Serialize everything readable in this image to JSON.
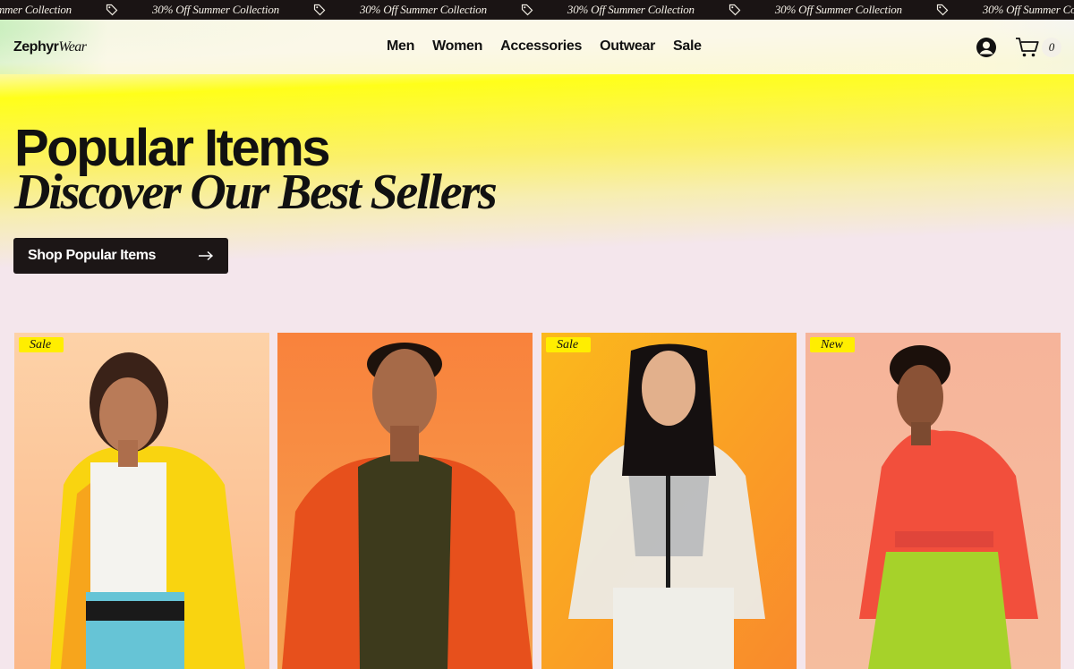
{
  "announcement": {
    "messages": [
      "30% Off Summer Collection",
      "30% Off Summer Collection",
      "30% Off Summer Collection",
      "30% Off Summer Collection",
      "30% Off Summer Collection",
      "30% Off Summer Collection"
    ],
    "icon": "tag-icon"
  },
  "header": {
    "logo_primary": "Zephyr",
    "logo_secondary": "Wear",
    "nav": [
      "Men",
      "Women",
      "Accessories",
      "Outwear",
      "Sale"
    ],
    "account_icon": "account-icon",
    "cart_icon": "cart-icon",
    "cart_count": "0"
  },
  "hero": {
    "title": "Popular Items",
    "subtitle": "Discover Our Best Sellers",
    "cta_label": "Shop Popular Items",
    "cta_icon": "arrow-right-icon"
  },
  "products": [
    {
      "badge": "Sale",
      "image": "model in yellow hooded jacket"
    },
    {
      "badge": "",
      "image": "model in orange hoodie"
    },
    {
      "badge": "Sale",
      "image": "model in translucent white jacket"
    },
    {
      "badge": "New",
      "image": "model in red cropped jacket"
    }
  ],
  "colors": {
    "ticker_bg": "#1a1414",
    "accent_yellow": "#ffee00",
    "page_bg": "#f4e6ec",
    "cta_bg": "#1c1616"
  }
}
